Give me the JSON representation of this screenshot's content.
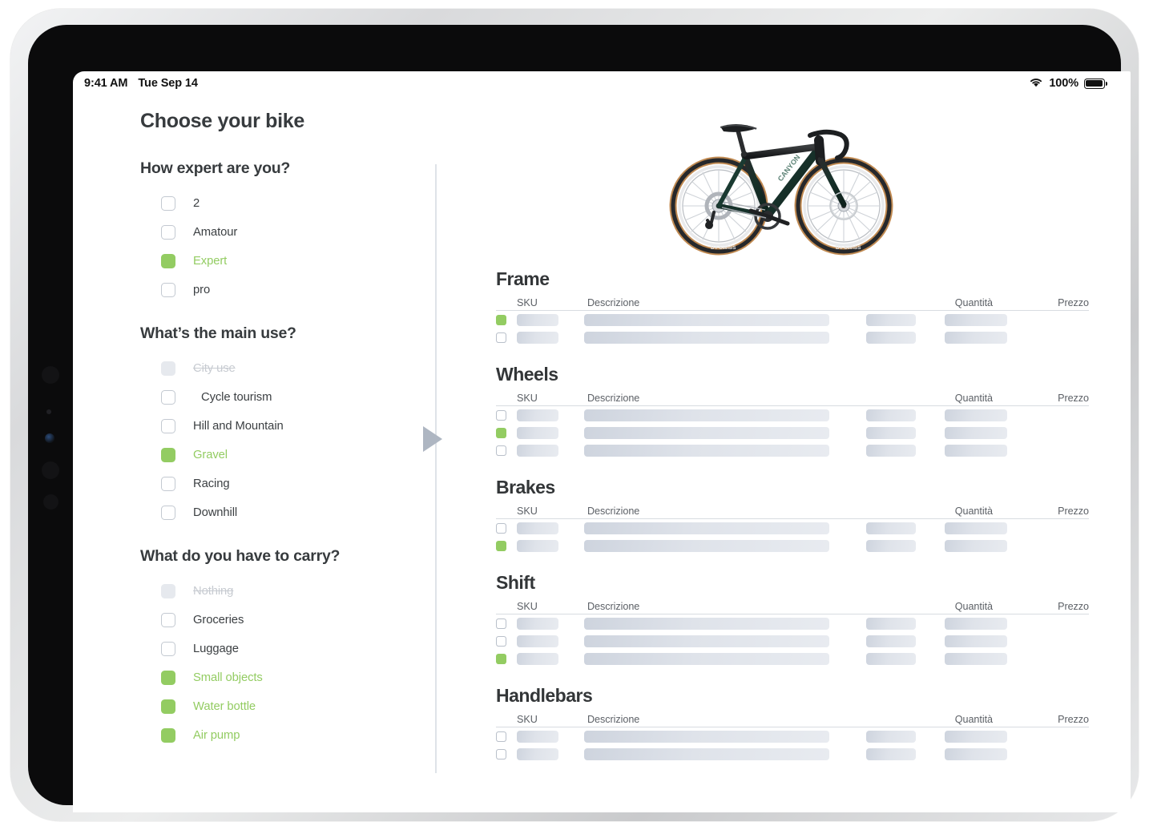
{
  "statusbar": {
    "time": "9:41 AM",
    "date": "Tue Sep 14",
    "wifi_icon": "wifi-icon",
    "battery_percent": "100%",
    "battery_icon": "battery-full-icon"
  },
  "page": {
    "title": "Choose your bike"
  },
  "accent": {
    "green": "#93cc62",
    "text_dark": "#373b3e",
    "placeholder_gray": "#dfe3ea",
    "divider": "#dfe3e8",
    "arrow_gray": "#aeb6c2"
  },
  "questions": [
    {
      "title": "How expert are you?",
      "options": [
        {
          "label": "2",
          "state": "unchecked",
          "indented": false
        },
        {
          "label": "Amatour",
          "state": "unchecked",
          "indented": false
        },
        {
          "label": "Expert",
          "state": "checked",
          "indented": false
        },
        {
          "label": "pro",
          "state": "unchecked",
          "indented": false
        }
      ]
    },
    {
      "title": "What’s the main use?",
      "options": [
        {
          "label": "City use",
          "state": "disabled",
          "indented": false
        },
        {
          "label": "Cycle tourism",
          "state": "unchecked",
          "indented": true
        },
        {
          "label": "Hill and Mountain",
          "state": "unchecked",
          "indented": false
        },
        {
          "label": "Gravel",
          "state": "checked",
          "indented": false
        },
        {
          "label": "Racing",
          "state": "unchecked",
          "indented": false
        },
        {
          "label": "Downhill",
          "state": "unchecked",
          "indented": false
        }
      ]
    },
    {
      "title": "What do you have to carry?",
      "options": [
        {
          "label": "Nothing",
          "state": "disabled",
          "indented": false
        },
        {
          "label": "Groceries",
          "state": "unchecked",
          "indented": false
        },
        {
          "label": "Luggage",
          "state": "unchecked",
          "indented": false
        },
        {
          "label": "Small objects",
          "state": "checked",
          "indented": false
        },
        {
          "label": "Water bottle",
          "state": "checked",
          "indented": false
        },
        {
          "label": "Air pump",
          "state": "checked",
          "indented": false
        }
      ]
    }
  ],
  "expand_control": {
    "icon": "play-triangle-icon"
  },
  "bike_preview": {
    "icon": "gravel-bicycle-image",
    "frame_color": "#1d3b31",
    "tire_sidewall_color": "#c08a52"
  },
  "table": {
    "columns": [
      "SKU",
      "Descrizione",
      "Quantità",
      "Prezzo"
    ]
  },
  "sections": [
    {
      "title": "Frame",
      "rows": [
        {
          "state": "checked"
        },
        {
          "state": "unchecked"
        }
      ]
    },
    {
      "title": "Wheels",
      "rows": [
        {
          "state": "unchecked"
        },
        {
          "state": "checked"
        },
        {
          "state": "unchecked"
        }
      ]
    },
    {
      "title": "Brakes",
      "rows": [
        {
          "state": "unchecked"
        },
        {
          "state": "checked"
        }
      ]
    },
    {
      "title": "Shift",
      "rows": [
        {
          "state": "unchecked"
        },
        {
          "state": "unchecked"
        },
        {
          "state": "checked"
        }
      ]
    },
    {
      "title": "Handlebars",
      "rows": [
        {
          "state": "unchecked"
        },
        {
          "state": "unchecked"
        }
      ]
    }
  ]
}
